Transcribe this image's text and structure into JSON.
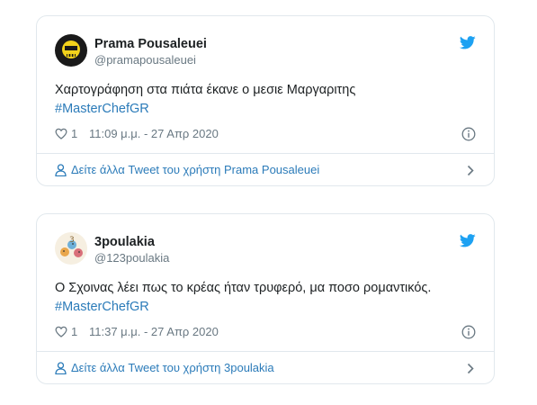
{
  "tweets": [
    {
      "display_name": "Prama Pousaleuei",
      "handle": "@pramapousaleuei",
      "avatar": "skull-avatar",
      "text": "Χαρτογράφηση στα πιάτα έκανε ο μεσιε Μαργαριτης",
      "hashtag": "#MasterChefGR",
      "likes": "1",
      "timestamp": "11:09 μ.μ. - 27 Απρ 2020",
      "more_link": "Δείτε άλλα Tweet του χρήστη Prama Pousaleuei"
    },
    {
      "display_name": "3poulakia",
      "handle": "@123poulakia",
      "avatar": "birds-avatar",
      "text": "Ο Σχοινας λέει πως το κρέας ήταν τρυφερό, μα ποσο ρομαντικός.",
      "hashtag": "#MasterChefGR",
      "likes": "1",
      "timestamp": "11:37 μ.μ. - 27 Απρ 2020",
      "more_link": "Δείτε άλλα Tweet του χρήστη 3poulakia"
    }
  ],
  "colors": {
    "link": "#2b7bb9",
    "twitter_blue": "#1da1f2",
    "muted": "#697882",
    "border": "#e1e8ed"
  },
  "icons": [
    "twitter-bird-icon",
    "heart-icon",
    "info-icon",
    "person-icon",
    "chevron-right-icon"
  ]
}
